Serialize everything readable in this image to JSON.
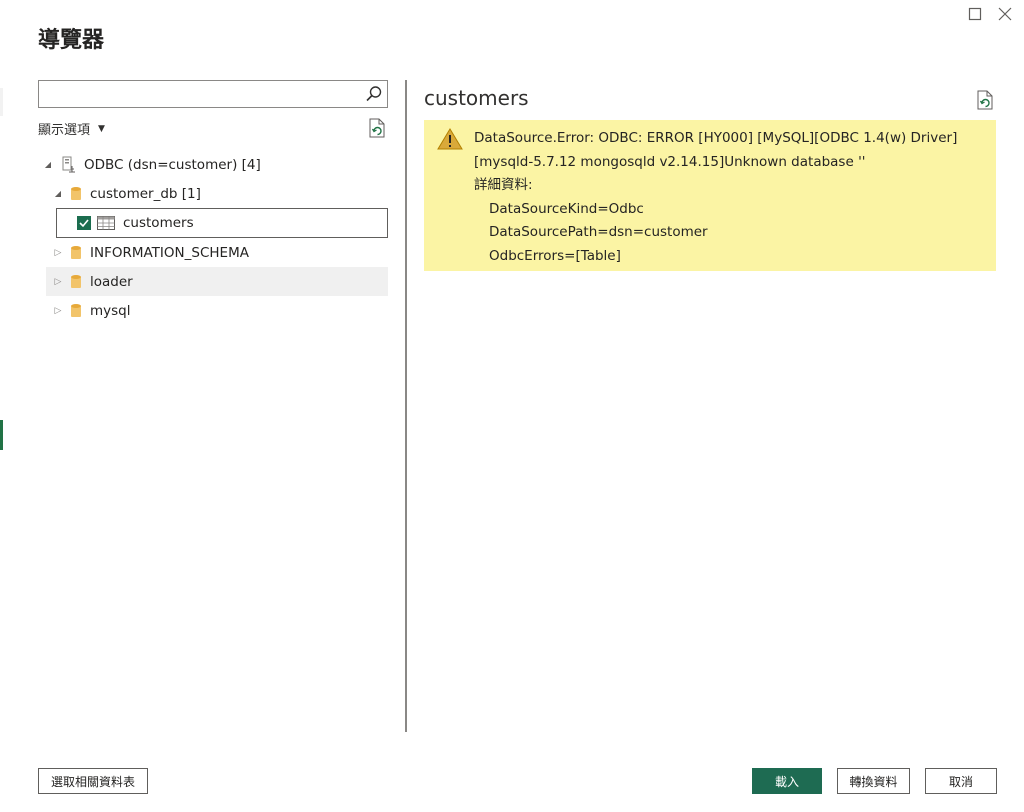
{
  "dialog": {
    "title": "導覽器"
  },
  "search": {
    "value": "",
    "placeholder": ""
  },
  "options": {
    "display_options_label": "顯示選項"
  },
  "tree": {
    "root_label": "ODBC (dsn=customer) [4]",
    "databases": [
      {
        "label": "customer_db [1]",
        "expanded": true
      },
      {
        "label": "INFORMATION_SCHEMA",
        "expanded": false
      },
      {
        "label": "loader",
        "expanded": false
      },
      {
        "label": "mysql",
        "expanded": false
      }
    ],
    "tables": [
      {
        "label": "customers",
        "checked": true
      }
    ]
  },
  "preview": {
    "title": "customers",
    "error_lines": [
      "DataSource.Error: ODBC: ERROR [HY000] [MySQL][ODBC 1.4(w) Driver]",
      "[mysqld-5.7.12 mongosqld v2.14.15]Unknown database ''",
      "詳細資料:",
      "DataSourceKind=Odbc",
      "DataSourcePath=dsn=customer",
      "OdbcErrors=[Table]"
    ]
  },
  "footer": {
    "select_related_label": "選取相關資料表",
    "load_label": "載入",
    "transform_label": "轉換資料",
    "cancel_label": "取消"
  },
  "colors": {
    "accent_green": "#1e6b52",
    "error_background": "#fbf4a4",
    "warning_icon": "#c19c00"
  },
  "icons": {
    "search": "search-icon",
    "refresh": "refresh-icon",
    "server": "server-icon",
    "database": "database-icon",
    "table": "table-icon",
    "warning": "warning-icon",
    "maximize": "maximize-icon",
    "close": "close-icon"
  }
}
